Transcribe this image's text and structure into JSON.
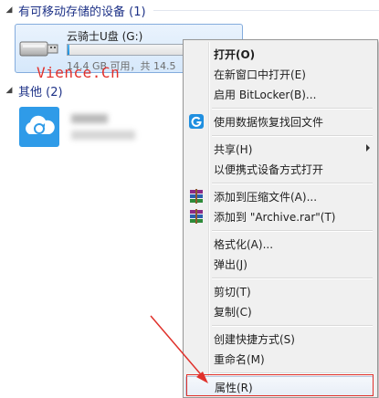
{
  "groups": {
    "devices_header": "有可移动存储的设备 (1)",
    "other_header": "其他 (2)"
  },
  "drive": {
    "name": "云骑士U盘 (G:)",
    "space_text": "14.4 GB 可用，共 14.5",
    "usage_fraction": 0.01,
    "icon": "usb-drive-icon"
  },
  "watermark": "Vience.Cn",
  "other_device": {
    "icon": "cloud-sync-icon",
    "icon_color": "#2f9be8"
  },
  "context_menu": {
    "items": [
      {
        "label": "打开(O)",
        "bold": true
      },
      {
        "label": "在新窗口中打开(E)"
      },
      {
        "label": "启用 BitLocker(B)..."
      },
      {
        "label": "使用数据恢复找回文件",
        "icon": "recovery-app-icon"
      },
      {
        "label": "共享(H)",
        "submenu": true
      },
      {
        "label": "以便携式设备方式打开"
      },
      {
        "label": "添加到压缩文件(A)...",
        "icon": "winrar-icon"
      },
      {
        "label": "添加到 \"Archive.rar\"(T)",
        "icon": "winrar-icon"
      },
      {
        "label": "格式化(A)..."
      },
      {
        "label": "弹出(J)"
      },
      {
        "label": "剪切(T)"
      },
      {
        "label": "复制(C)"
      },
      {
        "label": "创建快捷方式(S)"
      },
      {
        "label": "重命名(M)"
      },
      {
        "label": "属性(R)"
      }
    ]
  },
  "colors": {
    "accent": "#1e3287",
    "annotation_red": "#e0312b"
  }
}
